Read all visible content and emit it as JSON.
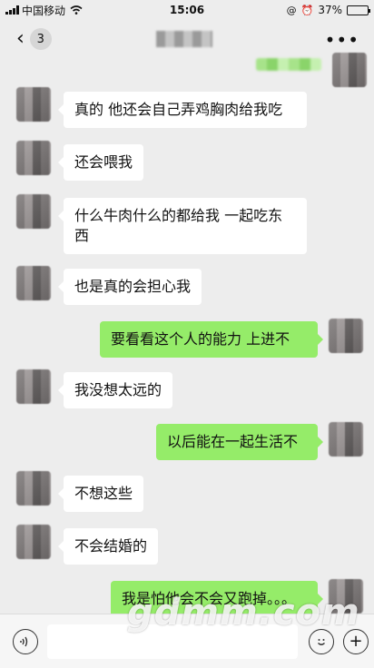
{
  "status_bar": {
    "carrier": "中国移动",
    "time": "15:06",
    "battery": "37%",
    "battery_level": 0.37
  },
  "nav": {
    "back_count": "3",
    "more_label": "•••"
  },
  "messages": [
    {
      "side": "right",
      "text": ""
    },
    {
      "side": "left",
      "text": "真的 他还会自己弄鸡胸肉给我吃"
    },
    {
      "side": "left",
      "text": "还会喂我"
    },
    {
      "side": "left",
      "text": "什么牛肉什么的都给我 一起吃东西"
    },
    {
      "side": "left",
      "text": "也是真的会担心我"
    },
    {
      "side": "right",
      "text": "要看看这个人的能力  上进不"
    },
    {
      "side": "left",
      "text": "我没想太远的"
    },
    {
      "side": "right",
      "text": "以后能在一起生活不"
    },
    {
      "side": "left",
      "text": "不想这些"
    },
    {
      "side": "left",
      "text": "不会结婚的"
    },
    {
      "side": "right",
      "text": "我是怕他会不会又跑掉。。。"
    }
  ],
  "input": {
    "value": "",
    "placeholder": ""
  },
  "watermark": "gdmm.com",
  "icons": {
    "voice": "voice-icon",
    "emoji": "emoji-icon",
    "plus": "plus-icon"
  },
  "colors": {
    "background": "#ededed",
    "bubble_self": "#95ec69",
    "bubble_other": "#ffffff"
  }
}
